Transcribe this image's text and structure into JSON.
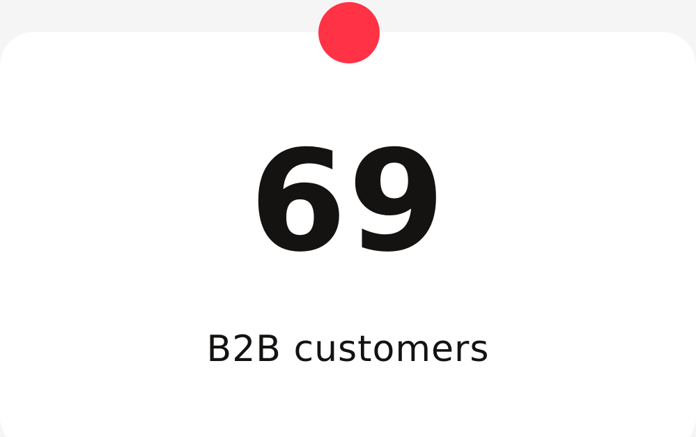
{
  "stat": {
    "value": "69",
    "label": "B2B customers"
  },
  "indicator": {
    "icon": "red-dot-icon",
    "color": "#ff3246"
  },
  "colors": {
    "background": "#f5f5f5",
    "card": "#ffffff",
    "text": "#151311"
  }
}
